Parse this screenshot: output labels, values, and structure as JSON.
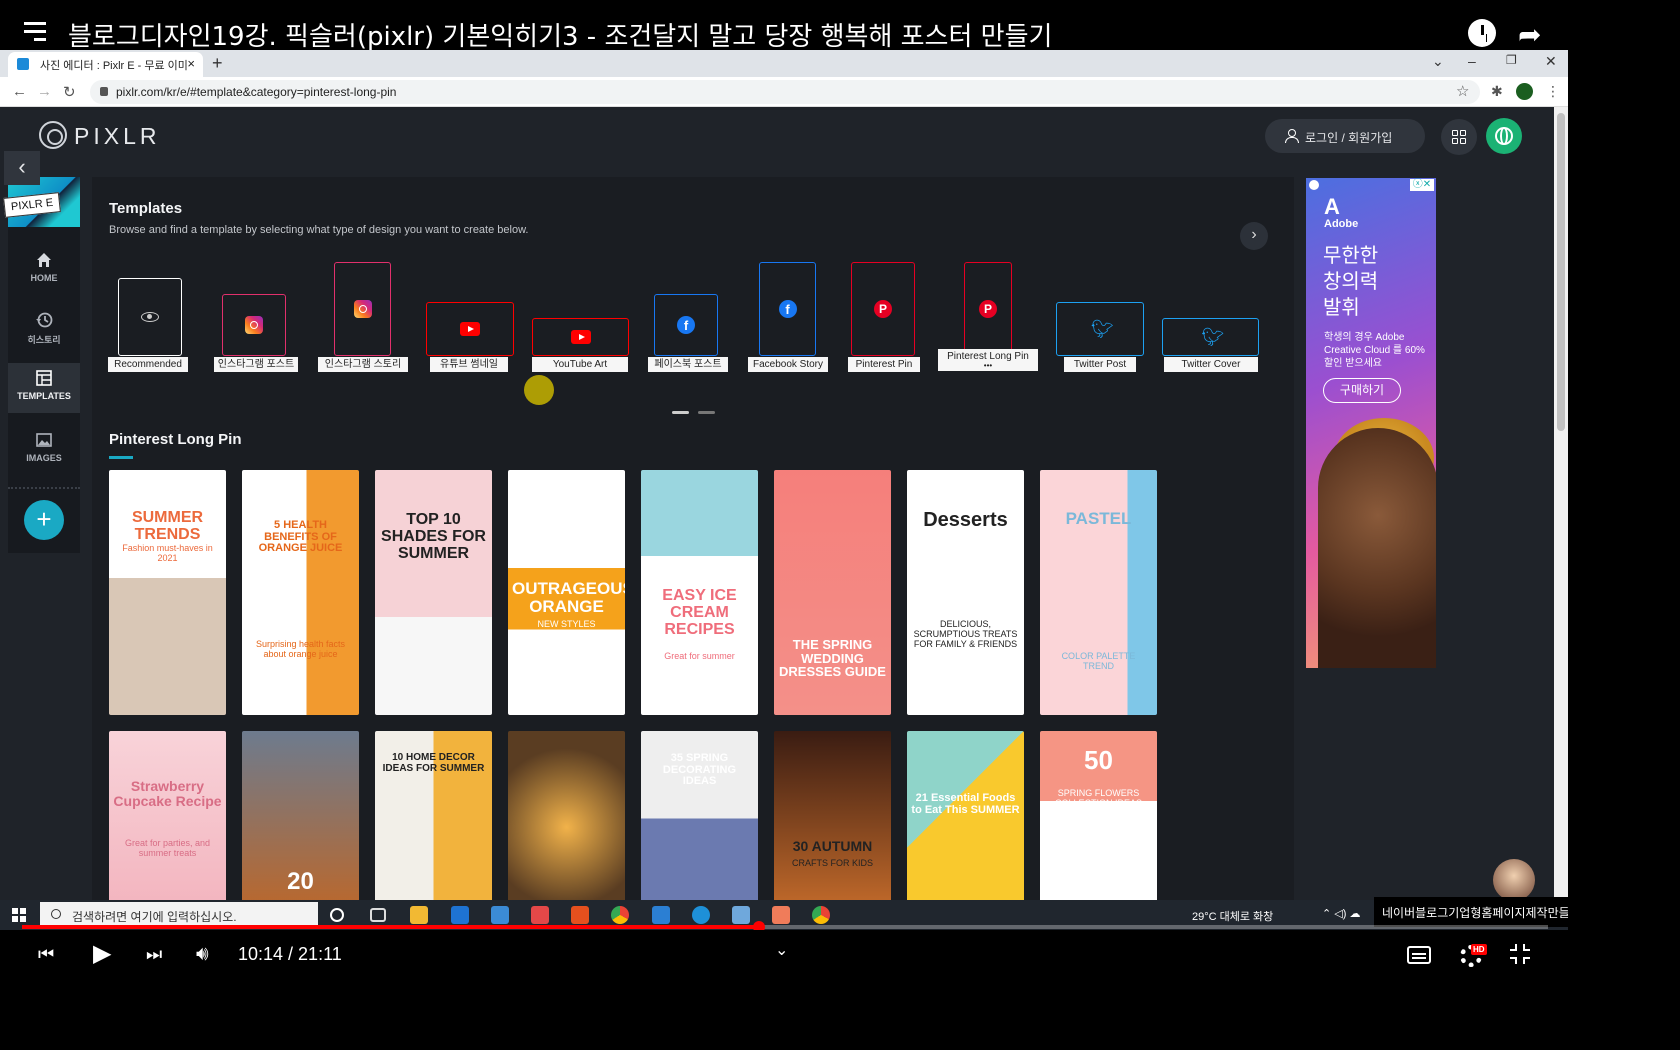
{
  "player": {
    "title": "블로그디자인19강. 픽슬러(pixlr) 기본익히기3 - 조건달지 말고 당장 행복해 포스터 만들기",
    "time": "10:14 / 21:11",
    "progress_fraction": 0.483,
    "hd_badge": "HD"
  },
  "browser": {
    "tab_title": "사진 에디터 : Pixlr E - 무료 이미",
    "tab_close": "×",
    "new_tab": "+",
    "url": "pixlr.com/kr/e/#template&category=pinterest-long-pin"
  },
  "pixlr": {
    "brand": "PIXLR",
    "editor_badge": "PIXLR E",
    "login_label": "로그인 / 회원가입",
    "back_label": "‹",
    "sidebar": [
      {
        "label": "HOME",
        "icon": "home-icon"
      },
      {
        "label": "히스토리",
        "icon": "history-icon"
      },
      {
        "label": "TEMPLATES",
        "icon": "templates-icon"
      },
      {
        "label": "IMAGES",
        "icon": "images-icon"
      }
    ],
    "plus_label": "+",
    "templates": {
      "title": "Templates",
      "subtitle": "Browse and find a template by selecting what type of design you want to create below.",
      "next_label": "›",
      "types": [
        {
          "label": "Recommended",
          "icon": "eye-icon",
          "color": "#ffffff"
        },
        {
          "label": "인스타그램 포스트",
          "icon": "instagram-icon",
          "color": "#e1306c"
        },
        {
          "label": "인스타그램 스토리",
          "icon": "instagram-icon",
          "color": "#e1306c"
        },
        {
          "label": "유튜브 썸네일",
          "icon": "youtube-icon",
          "color": "#ff0000"
        },
        {
          "label": "YouTube Art",
          "icon": "youtube-icon",
          "color": "#ff0000"
        },
        {
          "label": "페이스북 포스트",
          "icon": "facebook-icon",
          "color": "#1877f2"
        },
        {
          "label": "Facebook Story",
          "icon": "facebook-icon",
          "color": "#1877f2"
        },
        {
          "label": "Pinterest Pin",
          "icon": "pinterest-icon",
          "color": "#e60023"
        },
        {
          "label": "Pinterest Long Pin",
          "icon": "pinterest-icon",
          "color": "#e60023"
        },
        {
          "label": "Twitter Post",
          "icon": "twitter-icon",
          "color": "#1da1f2"
        },
        {
          "label": "Twitter Cover",
          "icon": "twitter-icon",
          "color": "#1da1f2"
        }
      ],
      "more_dots": "•••"
    },
    "section_title": "Pinterest Long Pin",
    "thumbnails_row1": [
      {
        "title": "SUMMER TRENDS",
        "sub": "Fashion must-haves in 2021"
      },
      {
        "title": "5 HEALTH BENEFITS OF ORANGE JUICE",
        "sub": "Surprising health facts about orange juice"
      },
      {
        "title": "TOP 10 SHADES FOR SUMMER",
        "sub": ""
      },
      {
        "title": "OUTRAGEOUS ORANGE",
        "sub": "NEW STYLES"
      },
      {
        "title": "EASY ICE CREAM RECIPES",
        "sub": "Great for summer"
      },
      {
        "title": "THE SPRING WEDDING DRESSES GUIDE",
        "sub": ""
      },
      {
        "title": "Desserts",
        "sub": "DELICIOUS, SCRUMPTIOUS TREATS FOR FAMILY & FRIENDS"
      },
      {
        "title": "PASTEL",
        "sub": "COLOR PALETTE TREND"
      }
    ],
    "thumbnails_row2": [
      {
        "title": "Strawberry Cupcake Recipe",
        "sub": "Great for parties, and summer treats"
      },
      {
        "title": "20",
        "sub": ""
      },
      {
        "title": "10 HOME DECOR IDEAS FOR SUMMER",
        "sub": ""
      },
      {
        "title": "",
        "sub": ""
      },
      {
        "title": "35 SPRING DECORATING IDEAS",
        "sub": ""
      },
      {
        "title": "30 AUTUMN",
        "sub": "CRAFTS FOR KIDS"
      },
      {
        "title": "21 Essential Foods to Eat This SUMMER",
        "sub": ""
      },
      {
        "title": "50",
        "sub": "SPRING FLOWERS COLLECTION IDEAS"
      }
    ],
    "ad": {
      "brand": "Adobe",
      "headline_lines": [
        "무한한",
        "창의력",
        "발휘"
      ],
      "sub": "학생의 경우 Adobe Creative Cloud 를 60% 할인 받으세요",
      "button": "구매하기",
      "close": "ⓧ✕"
    }
  },
  "taskbar": {
    "search_placeholder": "검색하려면 여기에 입력하십시오.",
    "weather": "29°C  대체로 화창",
    "overlay_text": "네이버블로그기업형홈페이지제작만들기"
  }
}
